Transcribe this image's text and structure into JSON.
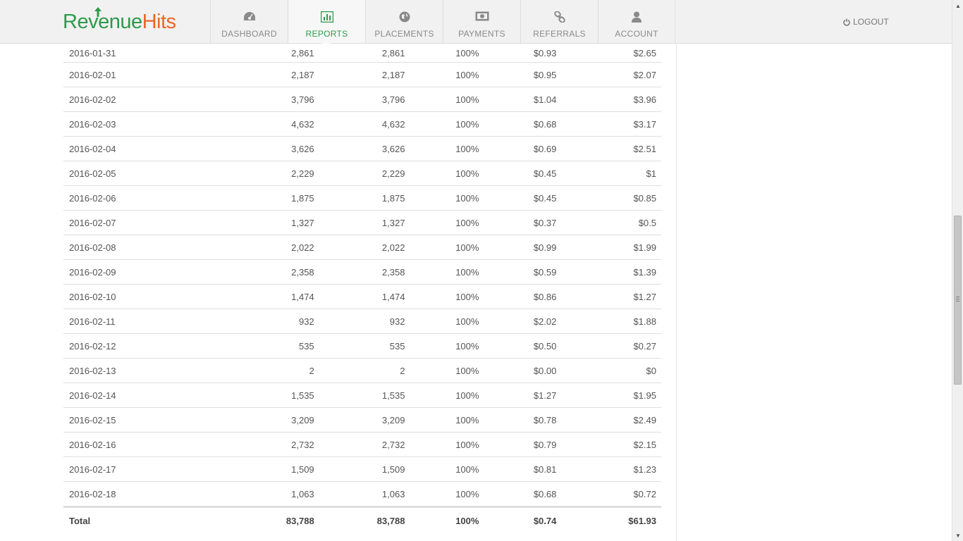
{
  "brand": {
    "logo_part1": "Rev",
    "logo_part2": "enue",
    "logo_part3": "Hits",
    "colors": {
      "green": "#2e9a4b",
      "orange": "#e8672a"
    }
  },
  "nav": {
    "items": [
      {
        "label": "DASHBOARD",
        "icon": "speedometer-icon",
        "active": false
      },
      {
        "label": "REPORTS",
        "icon": "bar-chart-icon",
        "active": true
      },
      {
        "label": "PLACEMENTS",
        "icon": "globe-icon",
        "active": false
      },
      {
        "label": "PAYMENTS",
        "icon": "banknote-icon",
        "active": false
      },
      {
        "label": "REFERRALS",
        "icon": "link-icon",
        "active": false
      },
      {
        "label": "ACCOUNT",
        "icon": "user-icon",
        "active": false
      }
    ],
    "logout_label": "LOGOUT"
  },
  "report": {
    "rows": [
      {
        "date": "2016-01-31",
        "impressions": "2,861",
        "paid": "2,861",
        "fill": "100%",
        "ecpm": "$0.93",
        "revenue": "$2.65"
      },
      {
        "date": "2016-02-01",
        "impressions": "2,187",
        "paid": "2,187",
        "fill": "100%",
        "ecpm": "$0.95",
        "revenue": "$2.07"
      },
      {
        "date": "2016-02-02",
        "impressions": "3,796",
        "paid": "3,796",
        "fill": "100%",
        "ecpm": "$1.04",
        "revenue": "$3.96"
      },
      {
        "date": "2016-02-03",
        "impressions": "4,632",
        "paid": "4,632",
        "fill": "100%",
        "ecpm": "$0.68",
        "revenue": "$3.17"
      },
      {
        "date": "2016-02-04",
        "impressions": "3,626",
        "paid": "3,626",
        "fill": "100%",
        "ecpm": "$0.69",
        "revenue": "$2.51"
      },
      {
        "date": "2016-02-05",
        "impressions": "2,229",
        "paid": "2,229",
        "fill": "100%",
        "ecpm": "$0.45",
        "revenue": "$1"
      },
      {
        "date": "2016-02-06",
        "impressions": "1,875",
        "paid": "1,875",
        "fill": "100%",
        "ecpm": "$0.45",
        "revenue": "$0.85"
      },
      {
        "date": "2016-02-07",
        "impressions": "1,327",
        "paid": "1,327",
        "fill": "100%",
        "ecpm": "$0.37",
        "revenue": "$0.5"
      },
      {
        "date": "2016-02-08",
        "impressions": "2,022",
        "paid": "2,022",
        "fill": "100%",
        "ecpm": "$0.99",
        "revenue": "$1.99"
      },
      {
        "date": "2016-02-09",
        "impressions": "2,358",
        "paid": "2,358",
        "fill": "100%",
        "ecpm": "$0.59",
        "revenue": "$1.39"
      },
      {
        "date": "2016-02-10",
        "impressions": "1,474",
        "paid": "1,474",
        "fill": "100%",
        "ecpm": "$0.86",
        "revenue": "$1.27"
      },
      {
        "date": "2016-02-11",
        "impressions": "932",
        "paid": "932",
        "fill": "100%",
        "ecpm": "$2.02",
        "revenue": "$1.88"
      },
      {
        "date": "2016-02-12",
        "impressions": "535",
        "paid": "535",
        "fill": "100%",
        "ecpm": "$0.50",
        "revenue": "$0.27"
      },
      {
        "date": "2016-02-13",
        "impressions": "2",
        "paid": "2",
        "fill": "100%",
        "ecpm": "$0.00",
        "revenue": "$0"
      },
      {
        "date": "2016-02-14",
        "impressions": "1,535",
        "paid": "1,535",
        "fill": "100%",
        "ecpm": "$1.27",
        "revenue": "$1.95"
      },
      {
        "date": "2016-02-15",
        "impressions": "3,209",
        "paid": "3,209",
        "fill": "100%",
        "ecpm": "$0.78",
        "revenue": "$2.49"
      },
      {
        "date": "2016-02-16",
        "impressions": "2,732",
        "paid": "2,732",
        "fill": "100%",
        "ecpm": "$0.79",
        "revenue": "$2.15"
      },
      {
        "date": "2016-02-17",
        "impressions": "1,509",
        "paid": "1,509",
        "fill": "100%",
        "ecpm": "$0.81",
        "revenue": "$1.23"
      },
      {
        "date": "2016-02-18",
        "impressions": "1,063",
        "paid": "1,063",
        "fill": "100%",
        "ecpm": "$0.68",
        "revenue": "$0.72"
      }
    ],
    "total": {
      "label": "Total",
      "impressions": "83,788",
      "paid": "83,788",
      "fill": "100%",
      "ecpm": "$0.74",
      "revenue": "$61.93"
    }
  }
}
